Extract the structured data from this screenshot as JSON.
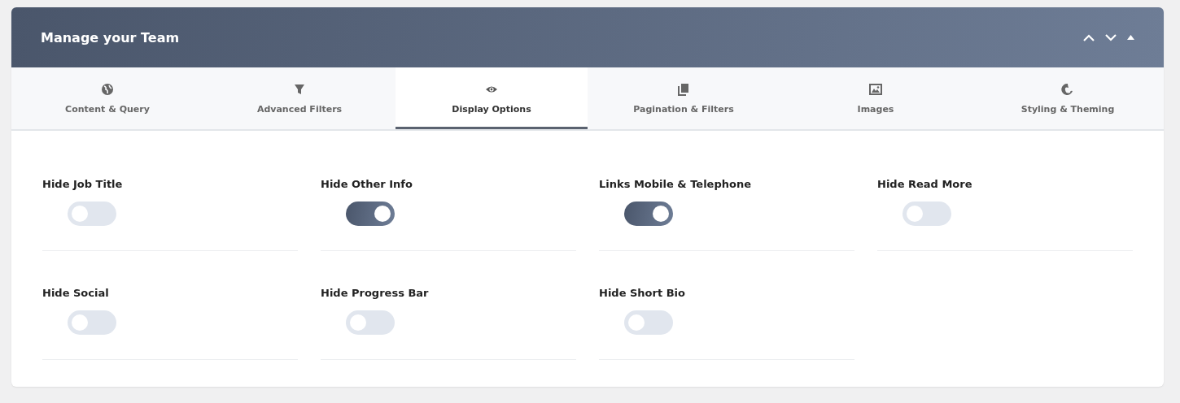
{
  "panel": {
    "title": "Manage your Team"
  },
  "tabs": [
    {
      "label": "Content & Query",
      "selected": false
    },
    {
      "label": "Advanced Filters",
      "selected": false
    },
    {
      "label": "Display Options",
      "selected": true
    },
    {
      "label": "Pagination & Filters",
      "selected": false
    },
    {
      "label": "Images",
      "selected": false
    },
    {
      "label": "Styling & Theming",
      "selected": false
    }
  ],
  "options": [
    {
      "label": "Hide Job Title",
      "on": false
    },
    {
      "label": "Hide Other Info",
      "on": true
    },
    {
      "label": "Links Mobile & Telephone",
      "on": true
    },
    {
      "label": "Hide Read More",
      "on": false
    },
    {
      "label": "Hide Social",
      "on": false
    },
    {
      "label": "Hide Progress Bar",
      "on": false
    },
    {
      "label": "Hide Short Bio",
      "on": false
    }
  ]
}
